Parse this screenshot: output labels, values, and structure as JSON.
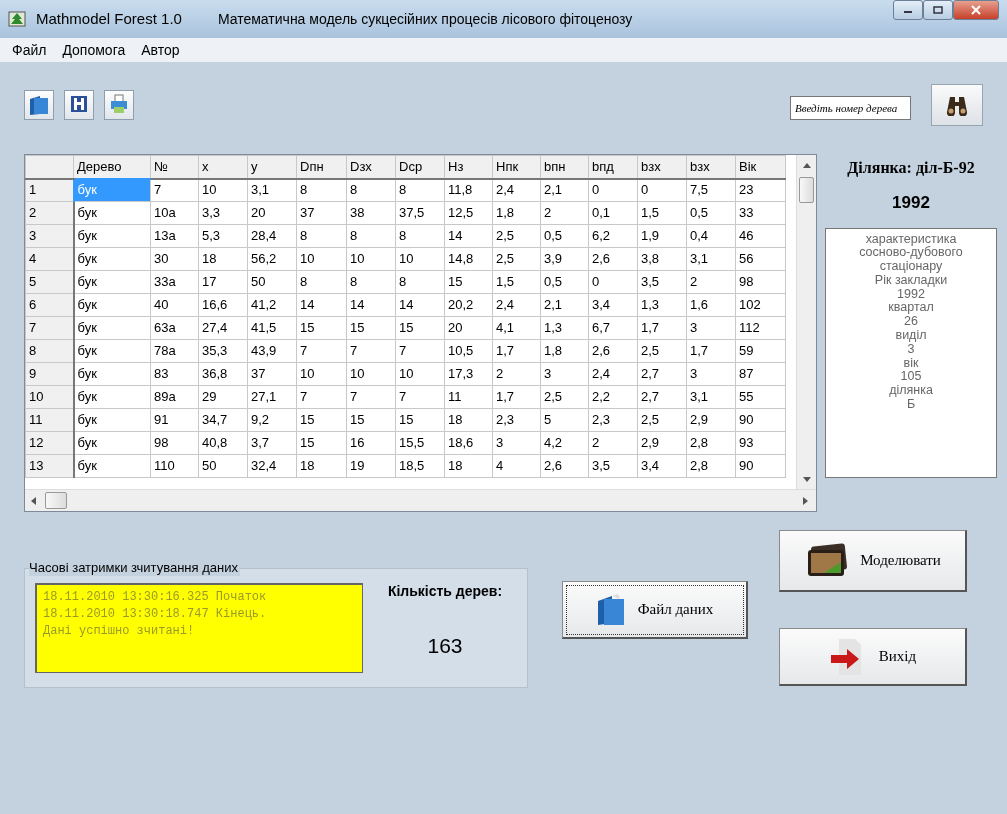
{
  "window": {
    "app_name": "Mathmodel Forest 1.0",
    "title": "Математична модель сукцесійних процесів лісового фітоценозу"
  },
  "menu": [
    "Файл",
    "Допомога",
    "Автор"
  ],
  "search": {
    "placeholder": "Введіть номер дерева"
  },
  "grid": {
    "columns": [
      {
        "label": "Дерево",
        "selected": true
      },
      {
        "label": "№",
        "selected": false
      },
      {
        "label": "x",
        "selected": false
      },
      {
        "label": "y",
        "selected": false
      },
      {
        "label": "Dпн",
        "selected": false
      },
      {
        "label": "Dзх",
        "selected": false
      },
      {
        "label": "Dср",
        "selected": false
      },
      {
        "label": "Hз",
        "selected": false
      },
      {
        "label": "Hпк",
        "selected": false
      },
      {
        "label": "bпн",
        "selected": false
      },
      {
        "label": "bпд",
        "selected": false
      },
      {
        "label": "bзх",
        "selected": false
      },
      {
        "label": "bзх",
        "selected": false
      },
      {
        "label": "Вік",
        "selected": false
      }
    ],
    "rows": [
      {
        "header": "1",
        "selected": true,
        "cells": [
          "бук",
          "7",
          "10",
          "3,1",
          "8",
          "8",
          "8",
          "11,8",
          "2,4",
          "2,1",
          "0",
          "0",
          "7,5",
          "23"
        ]
      },
      {
        "header": "2",
        "selected": false,
        "cells": [
          "бук",
          "10a",
          "3,3",
          "20",
          "37",
          "38",
          "37,5",
          "12,5",
          "1,8",
          "2",
          "0,1",
          "1,5",
          "0,5",
          "33"
        ]
      },
      {
        "header": "3",
        "selected": false,
        "cells": [
          "бук",
          "13a",
          "5,3",
          "28,4",
          "8",
          "8",
          "8",
          "14",
          "2,5",
          "0,5",
          "6,2",
          "1,9",
          "0,4",
          "46"
        ]
      },
      {
        "header": "4",
        "selected": false,
        "cells": [
          "бук",
          "30",
          "18",
          "56,2",
          "10",
          "10",
          "10",
          "14,8",
          "2,5",
          "3,9",
          "2,6",
          "3,8",
          "3,1",
          "56"
        ]
      },
      {
        "header": "5",
        "selected": false,
        "cells": [
          "бук",
          "33a",
          "17",
          "50",
          "8",
          "8",
          "8",
          "15",
          "1,5",
          "0,5",
          "0",
          "3,5",
          "2",
          "98"
        ]
      },
      {
        "header": "6",
        "selected": false,
        "cells": [
          "бук",
          "40",
          "16,6",
          "41,2",
          "14",
          "14",
          "14",
          "20,2",
          "2,4",
          "2,1",
          "3,4",
          "1,3",
          "1,6",
          "102"
        ]
      },
      {
        "header": "7",
        "selected": false,
        "cells": [
          "бук",
          "63a",
          "27,4",
          "41,5",
          "15",
          "15",
          "15",
          "20",
          "4,1",
          "1,3",
          "6,7",
          "1,7",
          "3",
          "112"
        ]
      },
      {
        "header": "8",
        "selected": false,
        "cells": [
          "бук",
          "78a",
          "35,3",
          "43,9",
          "7",
          "7",
          "7",
          "10,5",
          "1,7",
          "1,8",
          "2,6",
          "2,5",
          "1,7",
          "59"
        ]
      },
      {
        "header": "9",
        "selected": false,
        "cells": [
          "бук",
          "83",
          "36,8",
          "37",
          "10",
          "10",
          "10",
          "17,3",
          "2",
          "3",
          "2,4",
          "2,7",
          "3",
          "87"
        ]
      },
      {
        "header": "10",
        "selected": false,
        "cells": [
          "бук",
          "89a",
          "29",
          "27,1",
          "7",
          "7",
          "7",
          "11",
          "1,7",
          "2,5",
          "2,2",
          "2,7",
          "3,1",
          "55"
        ]
      },
      {
        "header": "11",
        "selected": false,
        "cells": [
          "бук",
          "91",
          "34,7",
          "9,2",
          "15",
          "15",
          "15",
          "18",
          "2,3",
          "5",
          "2,3",
          "2,5",
          "2,9",
          "90"
        ]
      },
      {
        "header": "12",
        "selected": false,
        "cells": [
          "бук",
          "98",
          "40,8",
          "3,7",
          "15",
          "16",
          "15,5",
          "18,6",
          "3",
          "4,2",
          "2",
          "2,9",
          "2,8",
          "93"
        ]
      },
      {
        "header": "13",
        "selected": false,
        "cells": [
          "бук",
          "110",
          "50",
          "32,4",
          "18",
          "19",
          "18,5",
          "18",
          "4",
          "2,6",
          "3,5",
          "3,4",
          "2,8",
          "90"
        ]
      }
    ]
  },
  "plot": {
    "title": "Ділянка: діл-Б-92",
    "year": "1992",
    "info_lines": [
      "характеристика",
      "сосново-дубового",
      "стаціонару",
      "Рік закладки",
      "1992",
      "квартал",
      "26",
      "виділ",
      "3",
      "вік",
      "105",
      "ділянка",
      "Б"
    ]
  },
  "log": {
    "legend": "Часові затримки зчитування даних",
    "lines": [
      "18.11.2010 13:30:16.325 Початок",
      "18.11.2010 13:30:18.747 Кінець.",
      "Дані успішно зчитані!"
    ]
  },
  "tree_count": {
    "label": "Кількість дерев:",
    "value": "163"
  },
  "buttons": [
    {
      "kind": "file",
      "label": "Файл даних",
      "focused": true
    },
    {
      "kind": "model",
      "label": "Моделювати",
      "focused": false
    },
    {
      "kind": "exit",
      "label": "Вихід",
      "focused": false
    }
  ]
}
